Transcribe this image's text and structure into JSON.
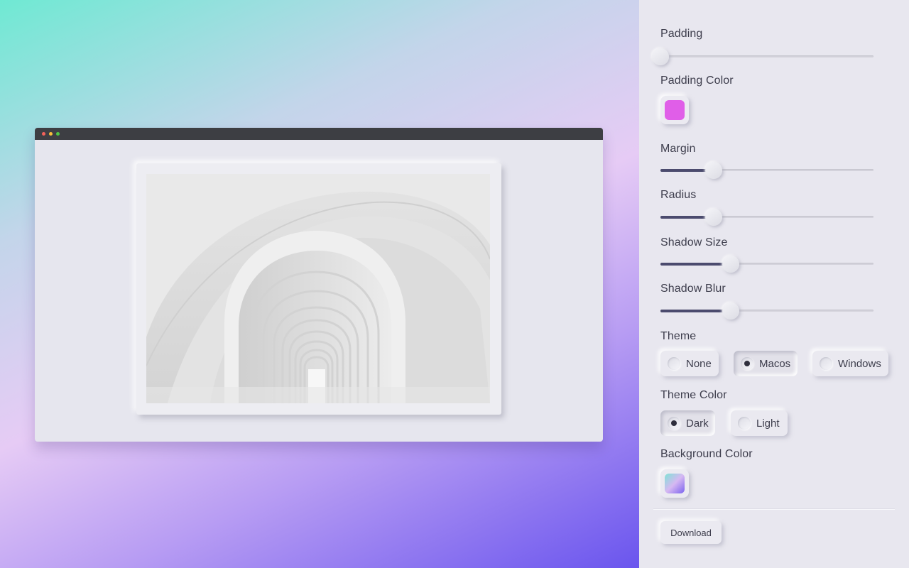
{
  "preview": {
    "window_theme": "macos-dark",
    "background_gradient": [
      "#6fe9d3",
      "#e6cbf5",
      "#6a55ee"
    ],
    "image_subject": "white arched corridor photograph"
  },
  "settings": {
    "padding": {
      "label": "Padding",
      "value": 0.0
    },
    "padding_color": {
      "label": "Padding Color",
      "color": "#e05ee8"
    },
    "margin": {
      "label": "Margin",
      "value": 0.25
    },
    "radius": {
      "label": "Radius",
      "value": 0.25
    },
    "shadow_size": {
      "label": "Shadow Size",
      "value": 0.33
    },
    "shadow_blur": {
      "label": "Shadow Blur",
      "value": 0.33
    },
    "theme": {
      "label": "Theme",
      "options": [
        "None",
        "Macos",
        "Windows"
      ],
      "selected": "Macos"
    },
    "theme_color": {
      "label": "Theme Color",
      "options": [
        "Dark",
        "Light"
      ],
      "selected": "Dark"
    },
    "background_color": {
      "label": "Background Color",
      "gradient": [
        "#7fe2d5",
        "#d6b8f2",
        "#7a62ef"
      ]
    }
  },
  "actions": {
    "download_label": "Download"
  }
}
